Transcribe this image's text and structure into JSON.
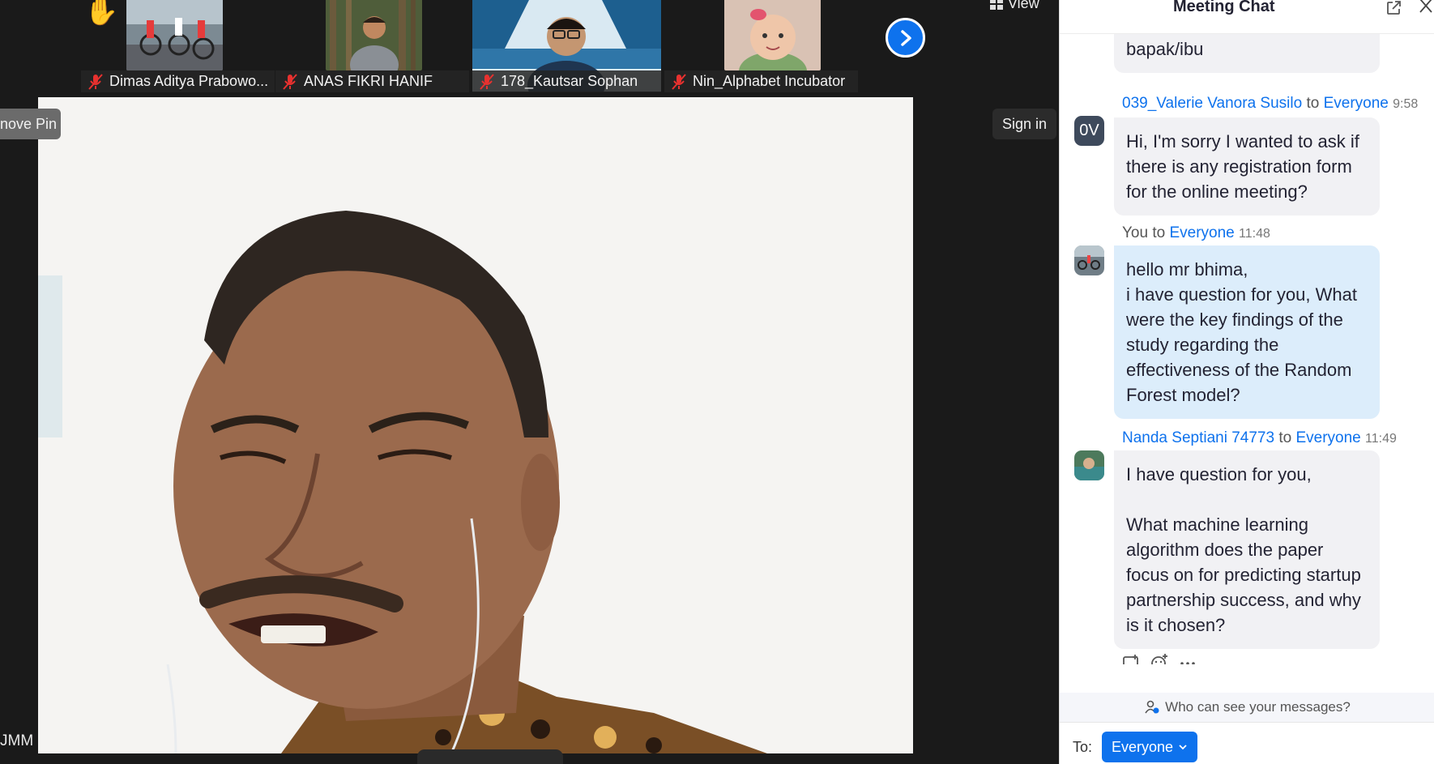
{
  "participants": [
    {
      "name": "Dimas Aditya Prabowo...",
      "raised_hand": true
    },
    {
      "name": "ANAS FIKRI HANIF",
      "raised_hand": false
    },
    {
      "name": "178_Kautsar Sophan",
      "raised_hand": false
    },
    {
      "name": "Nin_Alphabet Incubator",
      "raised_hand": false
    }
  ],
  "controls": {
    "view_label": "View",
    "remove_pin_label": "nove Pin",
    "sign_in_label": "Sign in",
    "corner_label": "JMM"
  },
  "chat": {
    "title": "Meeting Chat",
    "messages": [
      {
        "text": "Boleh dishare lagi linknya bapak/ibu",
        "mine": false
      },
      {
        "sender": "039_Valerie Vanora Susilo",
        "to": "to",
        "recipient": "Everyone",
        "time": "9:58",
        "avatar_initials": "0V",
        "text": "Hi, I'm sorry I wanted to ask if there is any registration form for the online meeting?",
        "mine": false
      },
      {
        "sender": "You",
        "to": "to",
        "recipient": "Everyone",
        "time": "11:48",
        "text": "hello mr bhima,\ni have question for you, What were the key findings of the study regarding the effectiveness of the Random Forest model?",
        "mine": true
      },
      {
        "sender": "Nanda Septiani 74773",
        "to": "to",
        "recipient": "Everyone",
        "time": "11:49",
        "text": "I have question for you,\n\nWhat machine learning algorithm does the paper focus on for predicting startup partnership success, and why is it chosen?",
        "mine": false
      }
    ],
    "visibility_text": "Who can see your messages?",
    "to_label": "To:",
    "recipient_button": "Everyone"
  }
}
